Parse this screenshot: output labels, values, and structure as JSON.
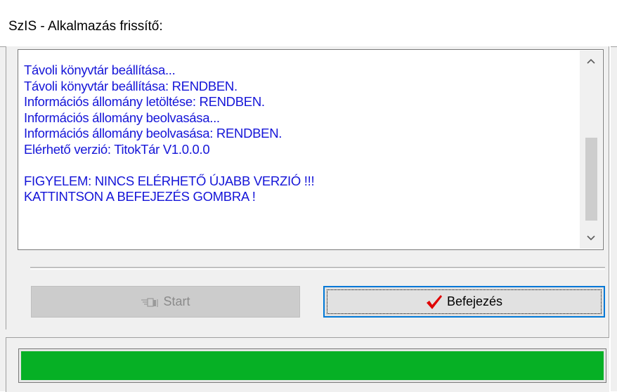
{
  "window": {
    "title": "SzIS - Alkalmazás frissítő:"
  },
  "log": {
    "lines": [
      "Távoli könyvtár beállítása...",
      "Távoli könyvtár beállítása: RENDBEN.",
      "Információs állomány letöltése: RENDBEN.",
      "Információs állomány beolvasása...",
      "Információs állomány beolvasása: RENDBEN.",
      "Elérhető verzió: TitokTár V1.0.0.0",
      "",
      "FIGYELEM: NINCS ELÉRHETŐ ÚJABB VERZIÓ !!!",
      "KATTINTSON A BEFEJEZÉS GOMBRA !"
    ],
    "text_color": "#1515d8",
    "scroll_up_icon": "chevron-up-icon",
    "scroll_down_icon": "chevron-down-icon"
  },
  "buttons": {
    "start": {
      "label": "Start",
      "icon": "pointing-hand-icon",
      "enabled": false
    },
    "finish": {
      "label": "Befejezés",
      "icon": "checkmark-icon",
      "icon_color": "#e00000",
      "focused": true
    }
  },
  "progress": {
    "value_fraction": 1.0,
    "color": "#06b025"
  }
}
